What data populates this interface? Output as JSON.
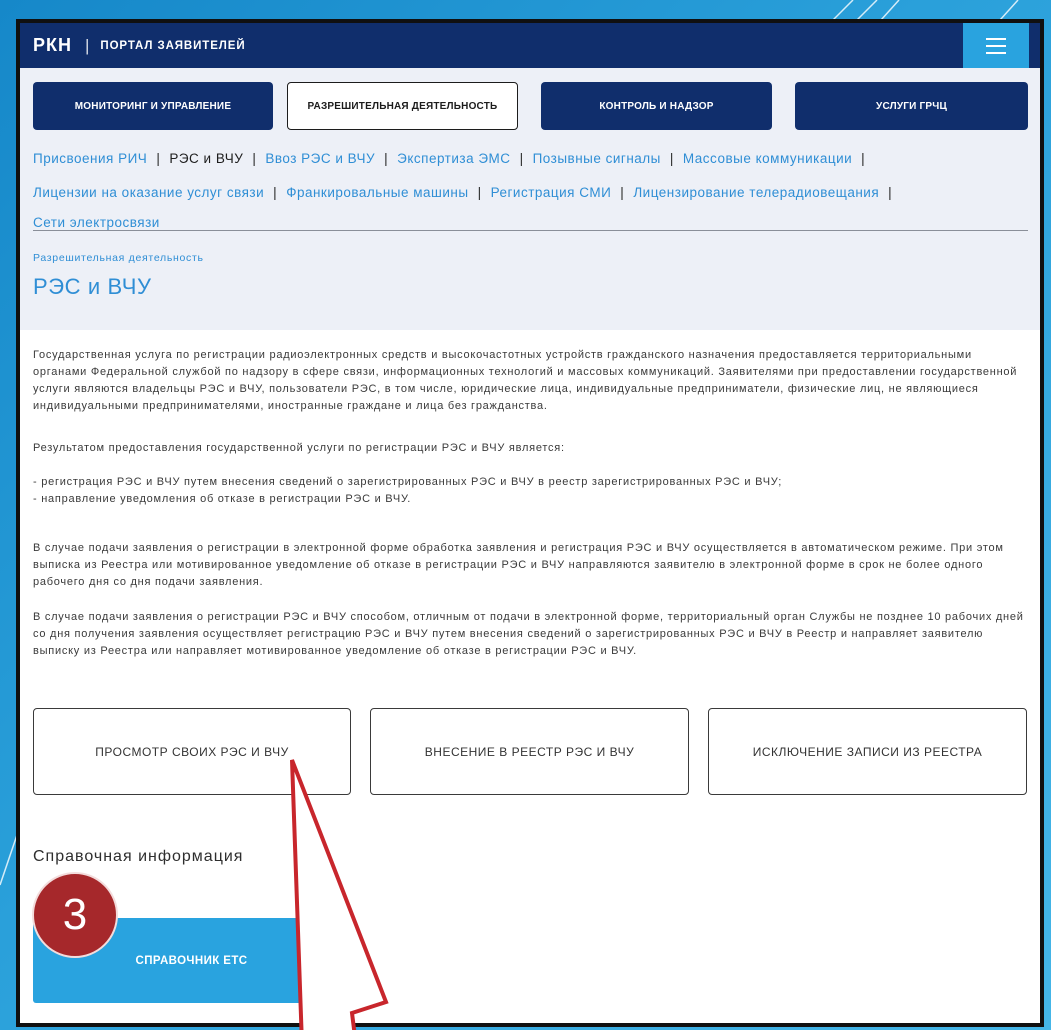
{
  "colors": {
    "navy": "#102e6c",
    "panel": "#edf0f7",
    "link": "#2f8ed5",
    "accent": "#29a3df",
    "text": "#3a3a3a",
    "badge": "#a6282b",
    "arrow": "#c8262c"
  },
  "header": {
    "logo_text": "РКН",
    "separator": "|",
    "portal_title": "ПОРТАЛ ЗАЯВИТЕЛЕЙ",
    "menu_icon": "hamburger-menu-icon"
  },
  "main_nav": {
    "items": [
      {
        "label": "МОНИТОРИНГ И УПРАВЛЕНИЕ",
        "active": false
      },
      {
        "label": "РАЗРЕШИТЕЛЬНАЯ ДЕЯТЕЛЬНОСТЬ",
        "active": true
      },
      {
        "label": "КОНТРОЛЬ И НАДЗОР",
        "active": false
      },
      {
        "label": "УСЛУГИ ГРЧЦ",
        "active": false
      }
    ]
  },
  "sub_nav": {
    "separator": "|",
    "rows": [
      [
        {
          "label": "Присвоения РИЧ",
          "current": false
        },
        {
          "label": "РЭС и ВЧУ",
          "current": true
        },
        {
          "label": "Ввоз РЭС и ВЧУ",
          "current": false
        },
        {
          "label": "Экспертиза ЭМС",
          "current": false
        },
        {
          "label": "Позывные сигналы",
          "current": false
        },
        {
          "label": "Массовые коммуникации",
          "current": false
        }
      ],
      [
        {
          "label": "Лицензии на оказание услуг связи",
          "current": false
        },
        {
          "label": "Франкировальные машины",
          "current": false
        },
        {
          "label": "Регистрация СМИ",
          "current": false
        },
        {
          "label": "Лицензирование телерадиовещания",
          "current": false
        }
      ],
      [
        {
          "label": "Сети электросвязи",
          "current": false
        }
      ]
    ]
  },
  "breadcrumb": "Разрешительная деятельность",
  "page_title": "РЭС и ВЧУ",
  "content": {
    "intro": "Государственная услуга по регистрации радиоэлектронных средств и высокочастотных устройств гражданского назначения предоставляется территориальными органами Федеральной службой по надзору в сфере связи, информационных технологий и массовых коммуникаций. Заявителями при предоставлении государственной услуги являются владельцы РЭС и ВЧУ, пользователи РЭС, в том числе, юридические лица, индивидуальные предприниматели, физические лиц, не являющиеся индивидуальными предпринимателями, иностранные граждане и лица без гражданства.",
    "result_intro": "Результатом предоставления государственной услуги по регистрации РЭС и ВЧУ является:",
    "result_items": [
      "- регистрация РЭС и ВЧУ путем внесения сведений о зарегистрированных РЭС и ВЧУ в реестр зарегистрированных РЭС и ВЧУ;",
      "- направление уведомления об отказе в регистрации РЭС и ВЧУ."
    ],
    "electronic_submission": "В случае подачи заявления о регистрации в электронной форме обработка заявления и регистрация РЭС и ВЧУ осуществляется в автоматическом режиме. При этом выписка из Реестра или мотивированное уведомление об отказе в регистрации РЭС и ВЧУ направляются заявителю в электронной форме в срок не более одного рабочего дня со дня подачи заявления.",
    "other_submission": "В случае подачи заявления о регистрации РЭС и ВЧУ способом, отличным от подачи в электронной форме, территориальный орган Службы не позднее 10 рабочих дней со дня получения заявления осуществляет регистрацию РЭС и ВЧУ путем внесения сведений о зарегистрированных РЭС и ВЧУ в Реестр и направляет заявителю выписку из Реестра или направляет мотивированное уведомление об отказе в регистрации РЭС и ВЧУ."
  },
  "actions": [
    {
      "label": "ПРОСМОТР СВОИХ РЭС И ВЧУ"
    },
    {
      "label": "ВНЕСЕНИЕ В РЕЕСТР РЭС И ВЧУ"
    },
    {
      "label": "ИСКЛЮЧЕНИЕ ЗАПИСИ ИЗ РЕЕСТРА"
    }
  ],
  "reference": {
    "heading": "Справочная информация",
    "button_label": "СПРАВОЧНИК ЕТС"
  },
  "annotation": {
    "step_number": "3",
    "arrow_icon": "pointer-arrow-icon"
  }
}
